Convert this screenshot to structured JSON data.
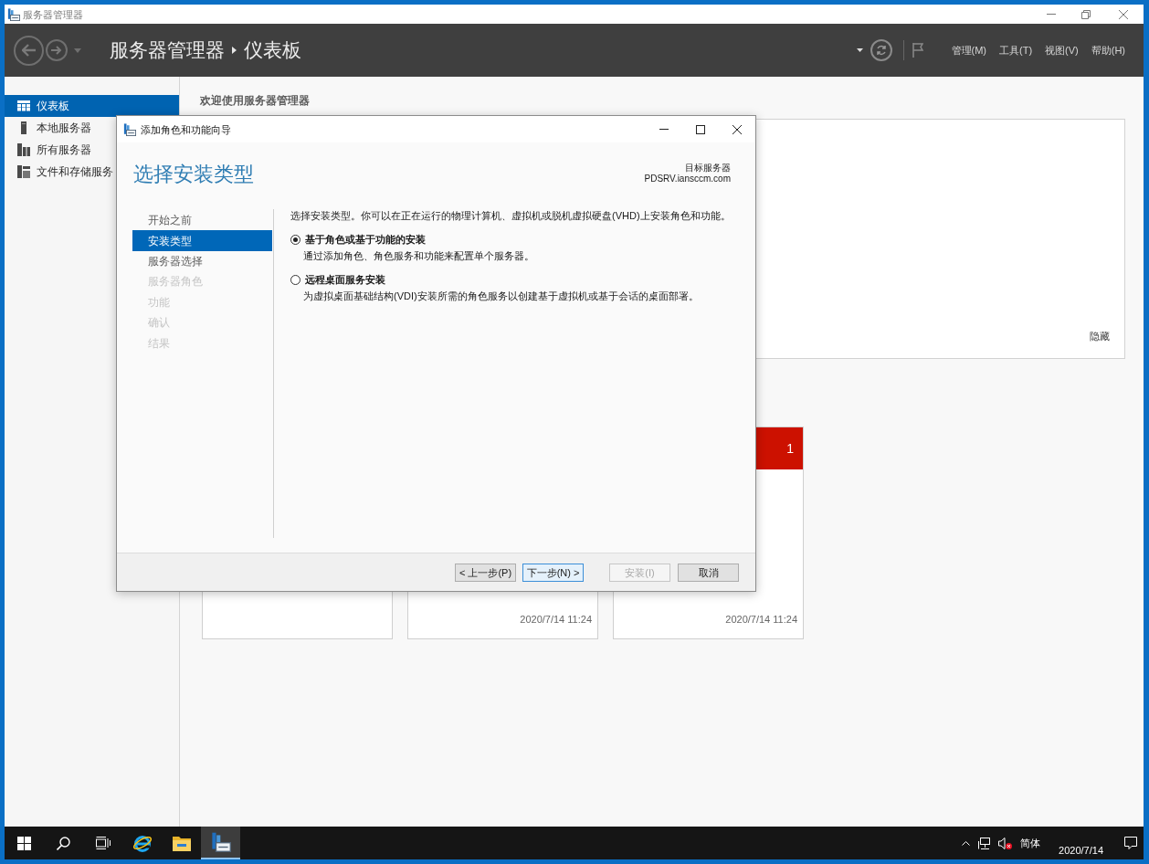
{
  "window": {
    "title": "服务器管理器"
  },
  "header": {
    "breadcrumb": [
      "服务器管理器",
      "仪表板"
    ],
    "menu": [
      "管理(M)",
      "工具(T)",
      "视图(V)",
      "帮助(H)"
    ]
  },
  "sidebar": {
    "items": [
      {
        "kind": "dashboard",
        "label": "仪表板",
        "selected": true
      },
      {
        "kind": "local-server",
        "label": "本地服务器",
        "selected": false
      },
      {
        "kind": "all-servers",
        "label": "所有服务器",
        "selected": false
      },
      {
        "kind": "file-storage",
        "label": "文件和存储服务",
        "selected": false
      }
    ]
  },
  "dashboard": {
    "welcome": "欢迎使用服务器管理器",
    "hide_link": "隐藏",
    "tiles": [
      {
        "timestamp": "2020/7/14 11:24"
      },
      {
        "alert": true,
        "count": "1",
        "timestamp": "2020/7/14 11:24"
      }
    ]
  },
  "wizard": {
    "title": "添加角色和功能向导",
    "heading": "选择安装类型",
    "target_label": "目标服务器",
    "target_server": "PDSRV.iansccm.com",
    "steps": [
      {
        "label": "开始之前",
        "selected": false,
        "disabled": false
      },
      {
        "label": "安装类型",
        "selected": true,
        "disabled": false
      },
      {
        "label": "服务器选择",
        "selected": false,
        "disabled": false
      },
      {
        "label": "服务器角色",
        "selected": false,
        "disabled": true
      },
      {
        "label": "功能",
        "selected": false,
        "disabled": true
      },
      {
        "label": "确认",
        "selected": false,
        "disabled": true
      },
      {
        "label": "结果",
        "selected": false,
        "disabled": true
      }
    ],
    "intro": "选择安装类型。你可以在正在运行的物理计算机、虚拟机或脱机虚拟硬盘(VHD)上安装角色和功能。",
    "options": [
      {
        "label": "基于角色或基于功能的安装",
        "description": "通过添加角色、角色服务和功能来配置单个服务器。",
        "selected": true
      },
      {
        "label": "远程桌面服务安装",
        "description": "为虚拟桌面基础结构(VDI)安装所需的角色服务以创建基于虚拟机或基于会话的桌面部署。",
        "selected": false
      }
    ],
    "nav_buttons": [
      {
        "label": "< 上一步(P)",
        "disabled": false,
        "focused": false
      },
      {
        "label": "下一步(N) >",
        "disabled": false,
        "focused": true
      }
    ],
    "action_buttons": [
      {
        "label": "安装(I)",
        "disabled": true
      },
      {
        "label": "取消",
        "disabled": false,
        "focused": false
      }
    ]
  },
  "taskbar": {
    "apps": [
      {
        "kind": "browser",
        "active": false
      },
      {
        "kind": "folder",
        "active": false
      },
      {
        "kind": "server-manager",
        "active": true
      }
    ],
    "ime": "简体",
    "date": "2020/7/14"
  }
}
